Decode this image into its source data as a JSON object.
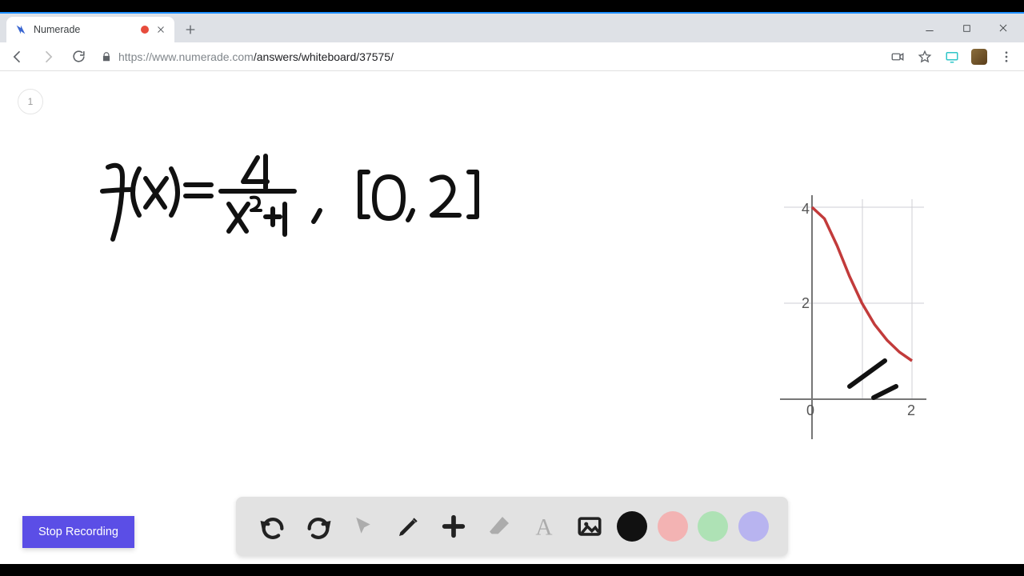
{
  "browser": {
    "tab_title": "Numerade",
    "url_host": "https://www.numerade.com",
    "url_path": "/answers/whiteboard/37575/"
  },
  "page": {
    "page_number": "1"
  },
  "whiteboard": {
    "equation_text": "f(x) = 4 / (x²+1) , [0, 2]"
  },
  "chart_data": {
    "type": "line",
    "title": "",
    "xlabel": "",
    "ylabel": "",
    "xlim": [
      0,
      2
    ],
    "ylim": [
      0,
      4
    ],
    "ticks_x": [
      0,
      2
    ],
    "ticks_y": [
      2,
      4
    ],
    "series": [
      {
        "name": "f(x)=4/(x²+1)",
        "color": "#c23b3b",
        "x": [
          0.0,
          0.25,
          0.5,
          0.75,
          1.0,
          1.25,
          1.5,
          1.75,
          2.0
        ],
        "values": [
          4.0,
          3.76,
          3.2,
          2.56,
          2.0,
          1.56,
          1.23,
          0.98,
          0.8
        ]
      }
    ],
    "tick_labels": {
      "x0": "0",
      "x2": "2",
      "y2": "2",
      "y4": "4"
    }
  },
  "toolbar": {
    "stop_label": "Stop Recording",
    "tools": {
      "undo": "undo-icon",
      "redo": "redo-icon",
      "cursor": "cursor-icon",
      "pencil": "pencil-icon",
      "add": "plus-icon",
      "eraser": "eraser-icon",
      "text": "text-icon",
      "image": "image-icon"
    },
    "colors": [
      "black",
      "pink",
      "green",
      "purple"
    ]
  }
}
